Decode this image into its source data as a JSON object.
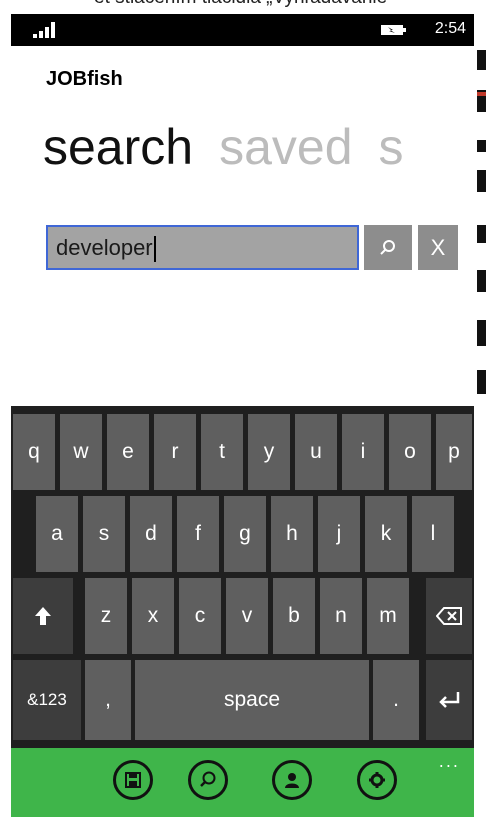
{
  "caption": "et stlačením tlačidla „Vyhľadávanie\"",
  "status_bar": {
    "time": "2:54"
  },
  "app": {
    "title": "JOBfish"
  },
  "pivot": {
    "tabs": [
      "search",
      "saved",
      "s"
    ]
  },
  "search": {
    "value": "developer",
    "clear_label": "X"
  },
  "keyboard": {
    "row1": [
      "q",
      "w",
      "e",
      "r",
      "t",
      "y",
      "u",
      "i",
      "o",
      "p"
    ],
    "row2": [
      "a",
      "s",
      "d",
      "f",
      "g",
      "h",
      "j",
      "k",
      "l"
    ],
    "row3": [
      "z",
      "x",
      "c",
      "v",
      "b",
      "n",
      "m"
    ],
    "symbols_key": "&123",
    "comma_key": ",",
    "space_key": "space",
    "period_key": "."
  },
  "app_bar": {
    "more": "..."
  },
  "colors": {
    "accent": "#3fb54a",
    "focus_border": "#3f67d6"
  }
}
